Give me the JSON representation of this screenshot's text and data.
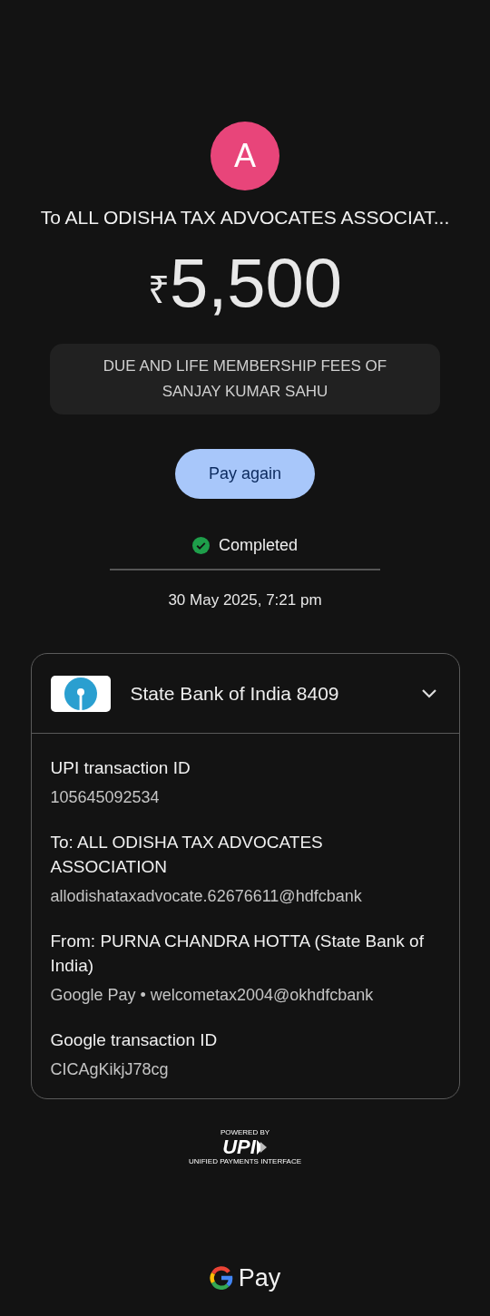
{
  "payee": {
    "initial": "A",
    "title": "To ALL ODISHA TAX ADVOCATES ASSOCIAT..."
  },
  "amount": {
    "currency": "₹",
    "value": "5,500"
  },
  "note": "DUE AND LIFE MEMBERSHIP FEES OF SANJAY KUMAR SAHU",
  "action_button": "Pay again",
  "status": {
    "kind": "success",
    "label": "Completed"
  },
  "datetime": "30 May 2025, 7:21 pm",
  "account_card": {
    "bank": "State Bank of India 8409",
    "expanded": true,
    "details": [
      {
        "label": "UPI transaction ID",
        "value": "105645092534"
      },
      {
        "label": "To: ALL ODISHA TAX ADVOCATES ASSOCIATION",
        "value": "allodishataxadvocate.62676611@hdfcbank"
      },
      {
        "label": "From: PURNA CHANDRA HOTTA (State Bank of India)",
        "value": "Google Pay • welcometax2004@okhdfcbank"
      },
      {
        "label": "Google transaction ID",
        "value": "CICAgKikjJ78cg"
      }
    ]
  },
  "upi_logo": {
    "top": "POWERED BY",
    "mark": "UPI",
    "bottom": "UNIFIED PAYMENTS INTERFACE"
  },
  "footer": {
    "brand": "Pay"
  }
}
